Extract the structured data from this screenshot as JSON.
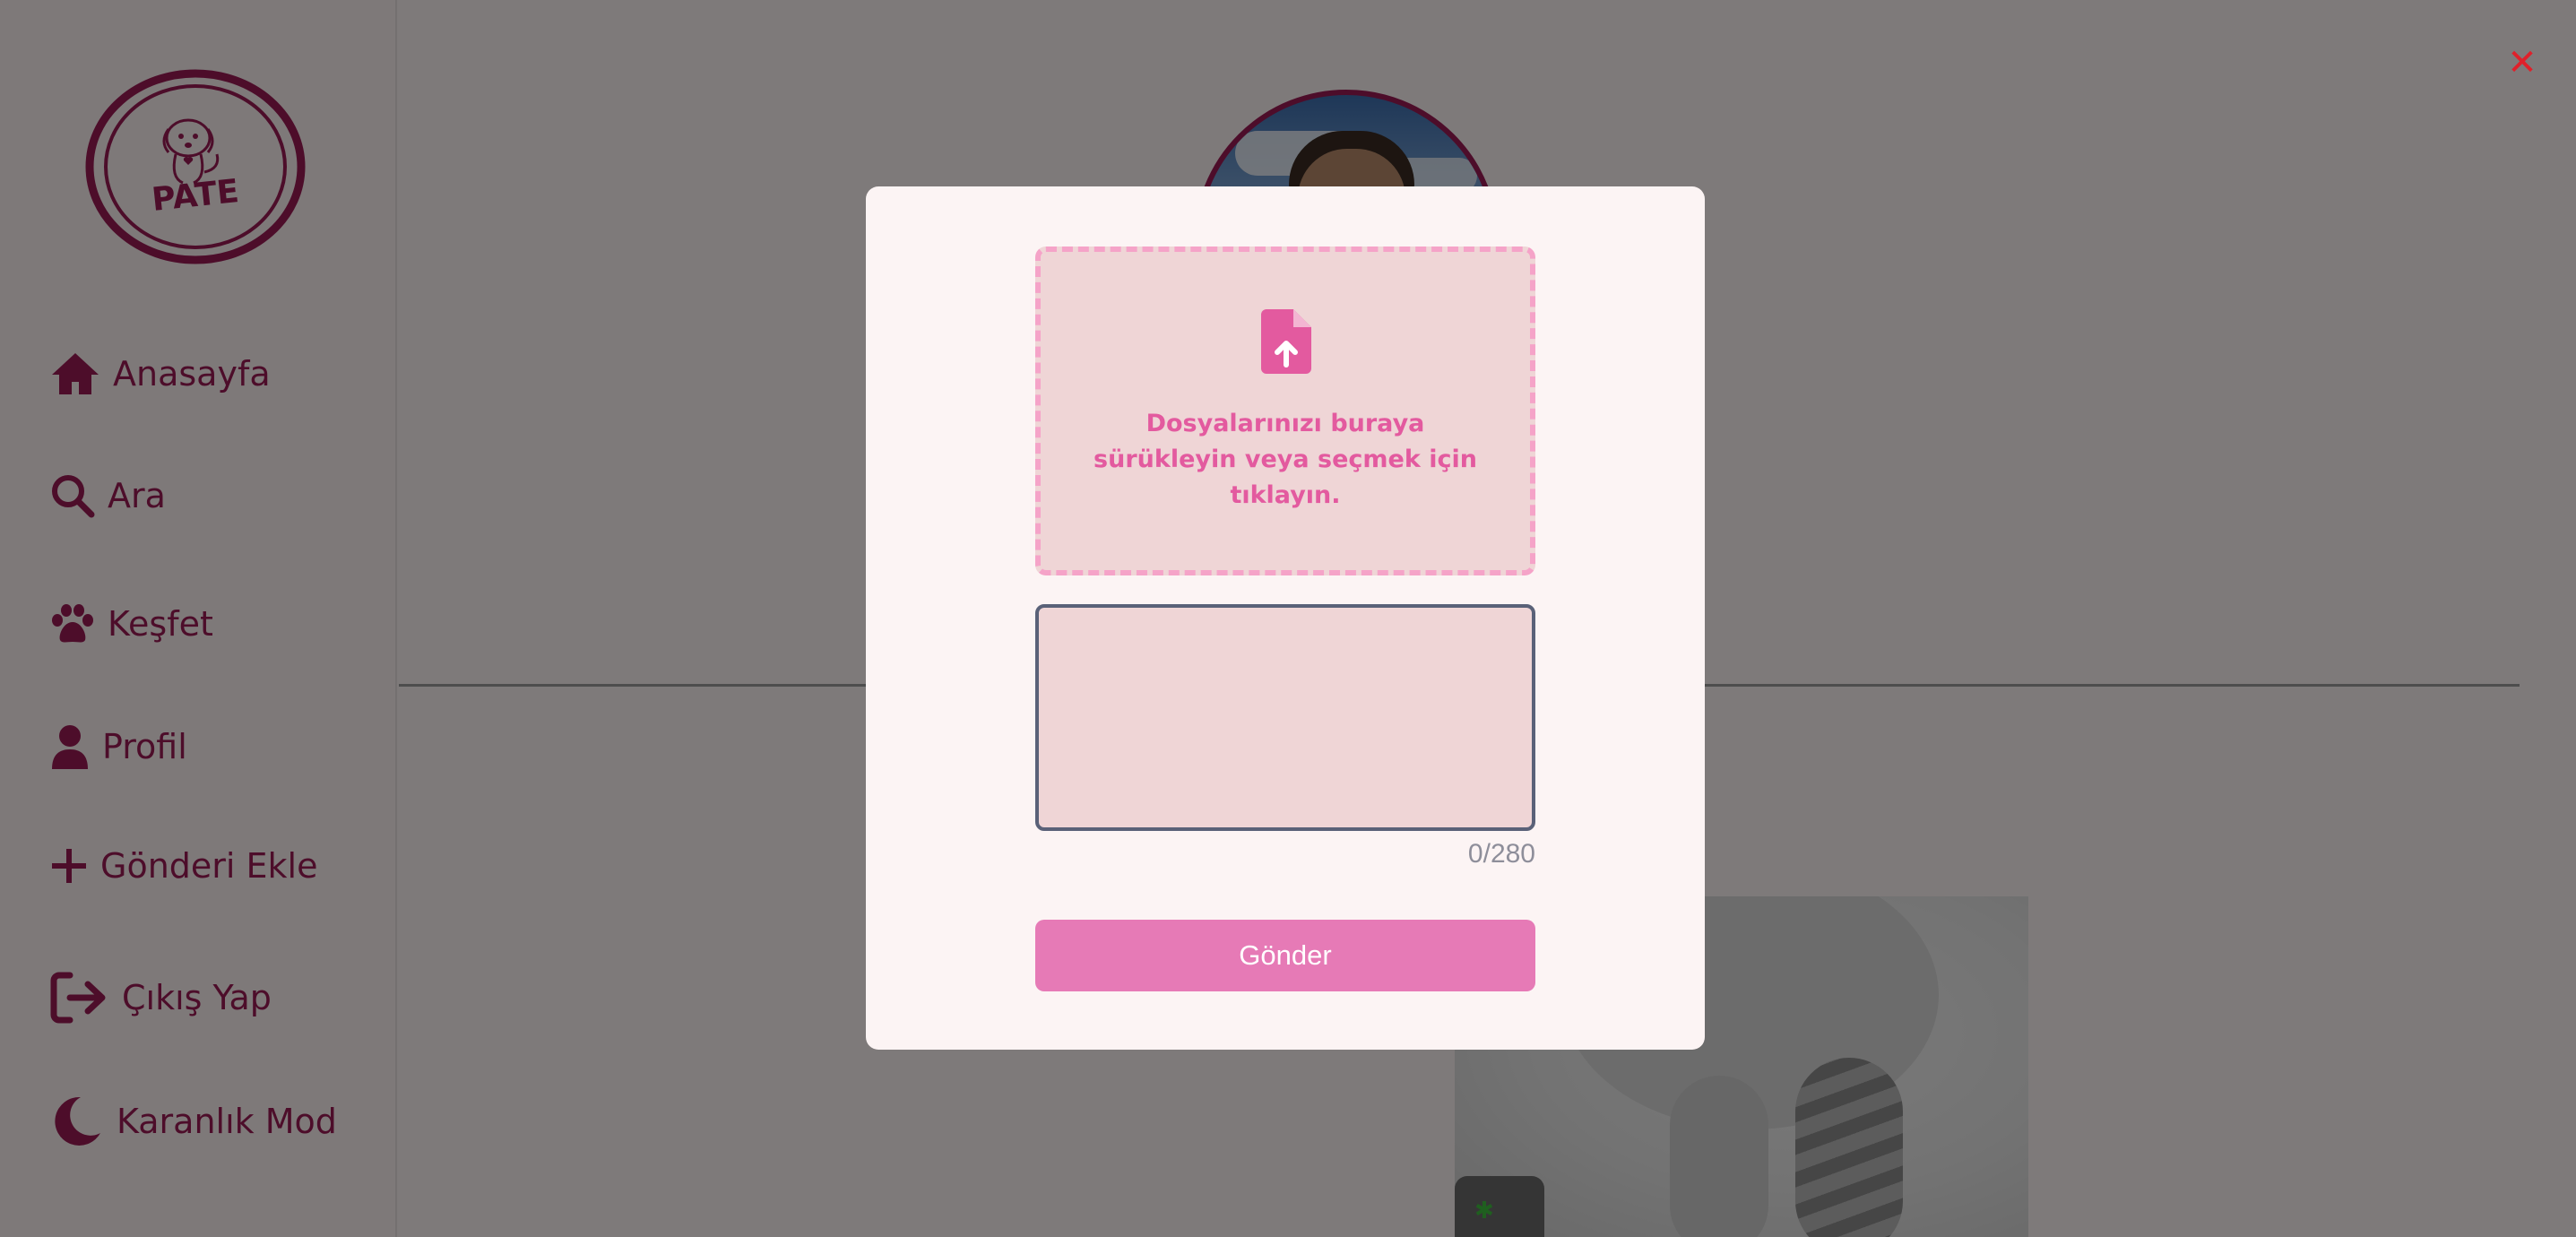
{
  "logo": {
    "text": "PATE",
    "icon": "dog-cat-logo"
  },
  "sidebar": {
    "items": [
      {
        "label": "Anasayfa",
        "icon": "home-icon"
      },
      {
        "label": "Ara",
        "icon": "search-icon"
      },
      {
        "label": "Keşfet",
        "icon": "paw-icon"
      },
      {
        "label": "Profil",
        "icon": "user-icon"
      },
      {
        "label": "Gönderi Ekle",
        "icon": "plus-icon"
      },
      {
        "label": "Çıkış Yap",
        "icon": "logout-icon"
      },
      {
        "label": "Karanlık Mod",
        "icon": "moon-icon"
      }
    ]
  },
  "modal": {
    "close_label": "✕",
    "dropzone": {
      "icon": "file-upload-icon",
      "text": "Dosyalarınızı buraya sürükleyin veya seçmek için tıklayın."
    },
    "textarea_value": "",
    "counter": "0/280",
    "submit_label": "Gönder"
  },
  "colors": {
    "brand": "#9b1b55",
    "accent_pink": "#e35a9f",
    "button": "#e67ab6",
    "dropzone_bg": "#efd5d6",
    "dropzone_border": "#f5a3c8",
    "close": "#e0202a"
  }
}
